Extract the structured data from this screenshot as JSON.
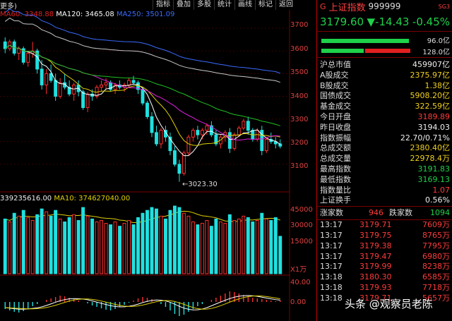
{
  "topbar": {
    "back": "更多)",
    "menu": [
      "指标",
      "叠加",
      "多股",
      "统计",
      "画线",
      "标记",
      "返回"
    ]
  },
  "ma_price": [
    {
      "label": "MA60: 3348.88",
      "color": "#e02020"
    },
    {
      "label": "MA120: 3465.08",
      "color": "#ffffff"
    },
    {
      "label": "MA250: 3501.09",
      "color": "#3a6cff"
    }
  ],
  "price_axis": [
    "3700",
    "3600",
    "3500",
    "3400",
    "3300",
    "3200",
    "3100"
  ],
  "low_label": "←3023.30",
  "vol_ma": [
    {
      "label": "339235616.00",
      "color": "#eeeeee"
    },
    {
      "label": "MA10: 374627040.00",
      "color": "#e0d000"
    }
  ],
  "vol_axis": [
    "45000",
    "30000",
    "15000",
    "X1万"
  ],
  "macd_axis": [
    "40.00",
    "0.00"
  ],
  "quote": {
    "flag": "G",
    "name": "上证指数",
    "code": "999999",
    "sg": "SG3",
    "price": "3179.60",
    "change": "▼-14.43",
    "pct": "-0.45%",
    "bar1": "96.0亿",
    "bar2": "128.0亿"
  },
  "stats": [
    {
      "k": "沪总市值",
      "v": "459907亿",
      "c": "w"
    },
    {
      "k": "A股成交",
      "v": "2375.97亿",
      "c": "y"
    },
    {
      "k": "B股成交",
      "v": "1.38亿",
      "c": "y"
    },
    {
      "k": "国债成交",
      "v": "5908.20亿",
      "c": "y"
    },
    {
      "k": "基金成交",
      "v": "322.59亿",
      "c": "y"
    },
    {
      "k": "今日开盘",
      "v": "3189.89",
      "c": "r"
    },
    {
      "k": "昨日收盘",
      "v": "3194.03",
      "c": "w"
    },
    {
      "k": "指数振幅",
      "v": "22.70/0.71%",
      "c": "w"
    },
    {
      "k": "总成交额",
      "v": "2380.40亿",
      "c": "y"
    },
    {
      "k": "总成交量",
      "v": "22978.4万",
      "c": "y"
    },
    {
      "k": "最高指数",
      "v": "3191.83",
      "c": "g"
    },
    {
      "k": "最低指数",
      "v": "3169.13",
      "c": "g"
    },
    {
      "k": "指数量比",
      "v": "1.07",
      "c": "r"
    },
    {
      "k": "上证换手",
      "v": "0.56%",
      "c": "w"
    }
  ],
  "updown": {
    "up_label": "涨家数",
    "up": "946",
    "down_label": "跌家数",
    "down": "1094"
  },
  "ticks": [
    {
      "t": "13:17",
      "p": "3179.71",
      "v": "7609万"
    },
    {
      "t": "13:17",
      "p": "3179.75",
      "v": "8765万"
    },
    {
      "t": "13:17",
      "p": "3179.38",
      "v": "7795万"
    },
    {
      "t": "13:17",
      "p": "3179.47",
      "v": "6980万"
    },
    {
      "t": "13:17",
      "p": "3179.99",
      "v": "8238万"
    },
    {
      "t": "13:18",
      "p": "3180.30",
      "v": "6585万"
    },
    {
      "t": "13:18",
      "p": "3179.93",
      "v": "7718万"
    },
    {
      "t": "13:18",
      "p": "3179.71",
      "v": "5657万"
    }
  ],
  "watermark": "头条 @观察员老陈",
  "chart_data": {
    "type": "candlestick",
    "price_range": [
      3000,
      3750
    ],
    "candles": [
      [
        3640,
        3660,
        3590,
        3610
      ],
      [
        3610,
        3650,
        3600,
        3640
      ],
      [
        3640,
        3650,
        3580,
        3590
      ],
      [
        3590,
        3620,
        3560,
        3610
      ],
      [
        3610,
        3620,
        3540,
        3550
      ],
      [
        3550,
        3600,
        3530,
        3590
      ],
      [
        3590,
        3640,
        3570,
        3600
      ],
      [
        3600,
        3610,
        3500,
        3520
      ],
      [
        3520,
        3560,
        3430,
        3450
      ],
      [
        3450,
        3520,
        3410,
        3500
      ],
      [
        3500,
        3540,
        3460,
        3470
      ],
      [
        3470,
        3500,
        3380,
        3400
      ],
      [
        3400,
        3480,
        3390,
        3460
      ],
      [
        3460,
        3500,
        3430,
        3440
      ],
      [
        3440,
        3470,
        3400,
        3410
      ],
      [
        3410,
        3460,
        3380,
        3450
      ],
      [
        3450,
        3470,
        3400,
        3420
      ],
      [
        3420,
        3430,
        3340,
        3350
      ],
      [
        3350,
        3420,
        3330,
        3410
      ],
      [
        3410,
        3430,
        3380,
        3400
      ],
      [
        3400,
        3450,
        3390,
        3440
      ],
      [
        3440,
        3470,
        3420,
        3450
      ],
      [
        3450,
        3480,
        3430,
        3460
      ],
      [
        3460,
        3470,
        3420,
        3430
      ],
      [
        3430,
        3460,
        3410,
        3450
      ],
      [
        3450,
        3470,
        3430,
        3440
      ],
      [
        3440,
        3460,
        3420,
        3450
      ],
      [
        3450,
        3480,
        3440,
        3470
      ],
      [
        3470,
        3490,
        3450,
        3460
      ],
      [
        3460,
        3470,
        3410,
        3430
      ],
      [
        3430,
        3440,
        3360,
        3370
      ],
      [
        3370,
        3380,
        3300,
        3310
      ],
      [
        3310,
        3330,
        3220,
        3240
      ],
      [
        3240,
        3270,
        3180,
        3190
      ],
      [
        3190,
        3260,
        3170,
        3250
      ],
      [
        3250,
        3270,
        3200,
        3220
      ],
      [
        3220,
        3240,
        3140,
        3160
      ],
      [
        3160,
        3180,
        3090,
        3100
      ],
      [
        3100,
        3120,
        3023,
        3060
      ],
      [
        3060,
        3160,
        3050,
        3150
      ],
      [
        3150,
        3230,
        3140,
        3220
      ],
      [
        3220,
        3260,
        3200,
        3250
      ],
      [
        3250,
        3270,
        3210,
        3230
      ],
      [
        3230,
        3260,
        3210,
        3250
      ],
      [
        3250,
        3280,
        3230,
        3270
      ],
      [
        3270,
        3290,
        3220,
        3230
      ],
      [
        3230,
        3250,
        3180,
        3190
      ],
      [
        3190,
        3230,
        3170,
        3220
      ],
      [
        3220,
        3250,
        3200,
        3240
      ],
      [
        3240,
        3260,
        3150,
        3170
      ],
      [
        3170,
        3240,
        3160,
        3230
      ],
      [
        3230,
        3270,
        3220,
        3260
      ],
      [
        3260,
        3300,
        3250,
        3290
      ],
      [
        3290,
        3310,
        3230,
        3250
      ],
      [
        3250,
        3260,
        3200,
        3210
      ],
      [
        3210,
        3260,
        3200,
        3250
      ],
      [
        3250,
        3270,
        3140,
        3160
      ],
      [
        3160,
        3220,
        3150,
        3210
      ],
      [
        3210,
        3240,
        3190,
        3200
      ],
      [
        3200,
        3220,
        3170,
        3190
      ],
      [
        3190,
        3210,
        3170,
        3180
      ]
    ],
    "volume_range": [
      0,
      48000
    ],
    "volumes": [
      38000,
      36000,
      42000,
      40000,
      44000,
      39000,
      37000,
      41000,
      45000,
      43000,
      40000,
      44000,
      38000,
      36000,
      39000,
      41000,
      37000,
      46000,
      40000,
      38000,
      36000,
      37000,
      35000,
      34000,
      36000,
      33000,
      35000,
      37000,
      34000,
      39000,
      42000,
      44000,
      46000,
      45000,
      40000,
      38000,
      44000,
      47000,
      46000,
      42000,
      40000,
      36000,
      34000,
      35000,
      37000,
      33000,
      38000,
      36000,
      35000,
      41000,
      37000,
      38000,
      40000,
      39000,
      36000,
      37000,
      42000,
      38000,
      37000,
      39000,
      26000
    ],
    "macd_range": [
      -60,
      60
    ],
    "macd": [
      -20,
      -24,
      -28,
      -30,
      -26,
      -20,
      -12,
      -6,
      0,
      6,
      10,
      14,
      18,
      16,
      12,
      8,
      4,
      0,
      -4,
      -10,
      -14,
      -18,
      -22,
      -24,
      -20,
      -14,
      -8,
      -2,
      4,
      10,
      14,
      12,
      8,
      2,
      -6,
      -14,
      -24,
      -34,
      -40,
      -36,
      -28,
      -20,
      -12,
      -6,
      0,
      6,
      12,
      18,
      24,
      30,
      28,
      24,
      20,
      16,
      12,
      10,
      8,
      6,
      4,
      2,
      4
    ]
  }
}
